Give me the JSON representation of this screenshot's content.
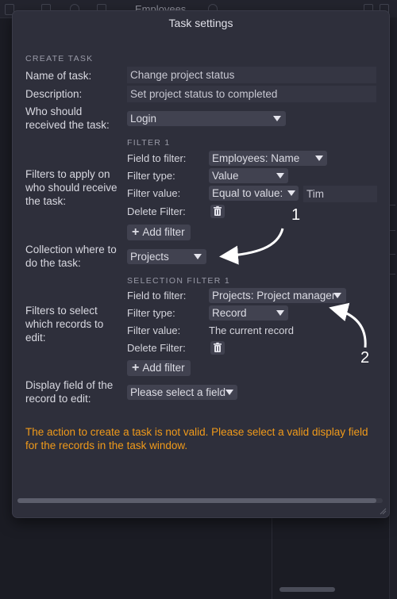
{
  "background": {
    "window_title": "Employees"
  },
  "dialog": {
    "title": "Task settings",
    "create_task_header": "CREATE TASK",
    "name_label": "Name of task:",
    "name_value": "Change project status",
    "description_label": "Description:",
    "description_value": "Set project status to completed",
    "who_label": "Who should received the task:",
    "who_value": "Login",
    "filters_label": "Filters to apply on who should receive the task:",
    "filter1": {
      "header": "FILTER 1",
      "field_label": "Field to filter:",
      "field_value": "Employees: Name",
      "type_label": "Filter type:",
      "type_value": "Value",
      "value_label": "Filter value:",
      "value_op": "Equal to value:",
      "value_text": "Tim",
      "delete_label": "Delete Filter:"
    },
    "add_filter_1": "Add filter",
    "collection_label": "Collection where to do the task:",
    "collection_value": "Projects",
    "selection_filter": {
      "header": "SELECTION FILTER 1",
      "field_label": "Field to filter:",
      "field_value": "Projects: Project manager",
      "type_label": "Filter type:",
      "type_value": "Record",
      "value_label": "Filter value:",
      "value_text": "The current record",
      "delete_label": "Delete Filter:"
    },
    "filters_select_label": "Filters to select which records to edit:",
    "add_filter_2": "Add filter",
    "display_label": "Display field of the record to edit:",
    "display_value": "Please select a field",
    "error_message": "The action to create a task is not valid. Please select a valid display field for the records in the task window."
  },
  "annotations": {
    "marker_1": "1",
    "marker_2": "2"
  },
  "colors": {
    "error": "#f09a1a",
    "dialog_bg": "#2e2f3b",
    "control_bg": "#414250"
  }
}
